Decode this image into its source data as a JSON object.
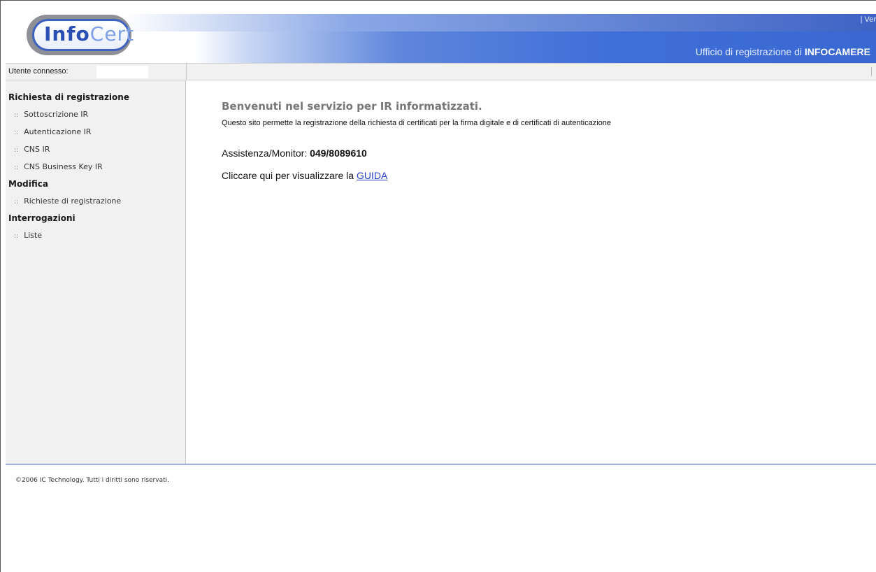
{
  "header": {
    "logo_left": "Info",
    "logo_right": "Cert",
    "top_right_link": "| Ver",
    "subtitle_prefix": "Ufficio di registrazione di ",
    "subtitle_org": "INFOCAMERE"
  },
  "userbar": {
    "label": "Utente connesso:"
  },
  "sidebar": {
    "sections": [
      {
        "title": "Richiesta di registrazione",
        "items": [
          "Sottoscrizione IR",
          "Autenticazione IR",
          "CNS IR",
          "CNS Business Key IR"
        ]
      },
      {
        "title": "Modifica",
        "items": [
          "Richieste di registrazione"
        ]
      },
      {
        "title": "Interrogazioni",
        "items": [
          "Liste"
        ]
      }
    ],
    "bullet": "::"
  },
  "main": {
    "welcome_title": "Benvenuti nel servizio per IR informatizzati.",
    "welcome_desc": "Questo sito permette la registrazione della richiesta di certificati per la firma digitale e di certificati di autenticazione",
    "support_label": "Assistenza/Monitor: ",
    "support_number": "049/8089610",
    "guide_text": "Cliccare qui per visualizzare la ",
    "guide_link": "GUIDA"
  },
  "footer": {
    "copyright": "©2006 IC Technology. Tutti i diritti sono riservati."
  },
  "colors": {
    "header_blue": "#3a68d2",
    "link": "#2a3fc8",
    "sidebar_bg": "#f1f1f1"
  }
}
